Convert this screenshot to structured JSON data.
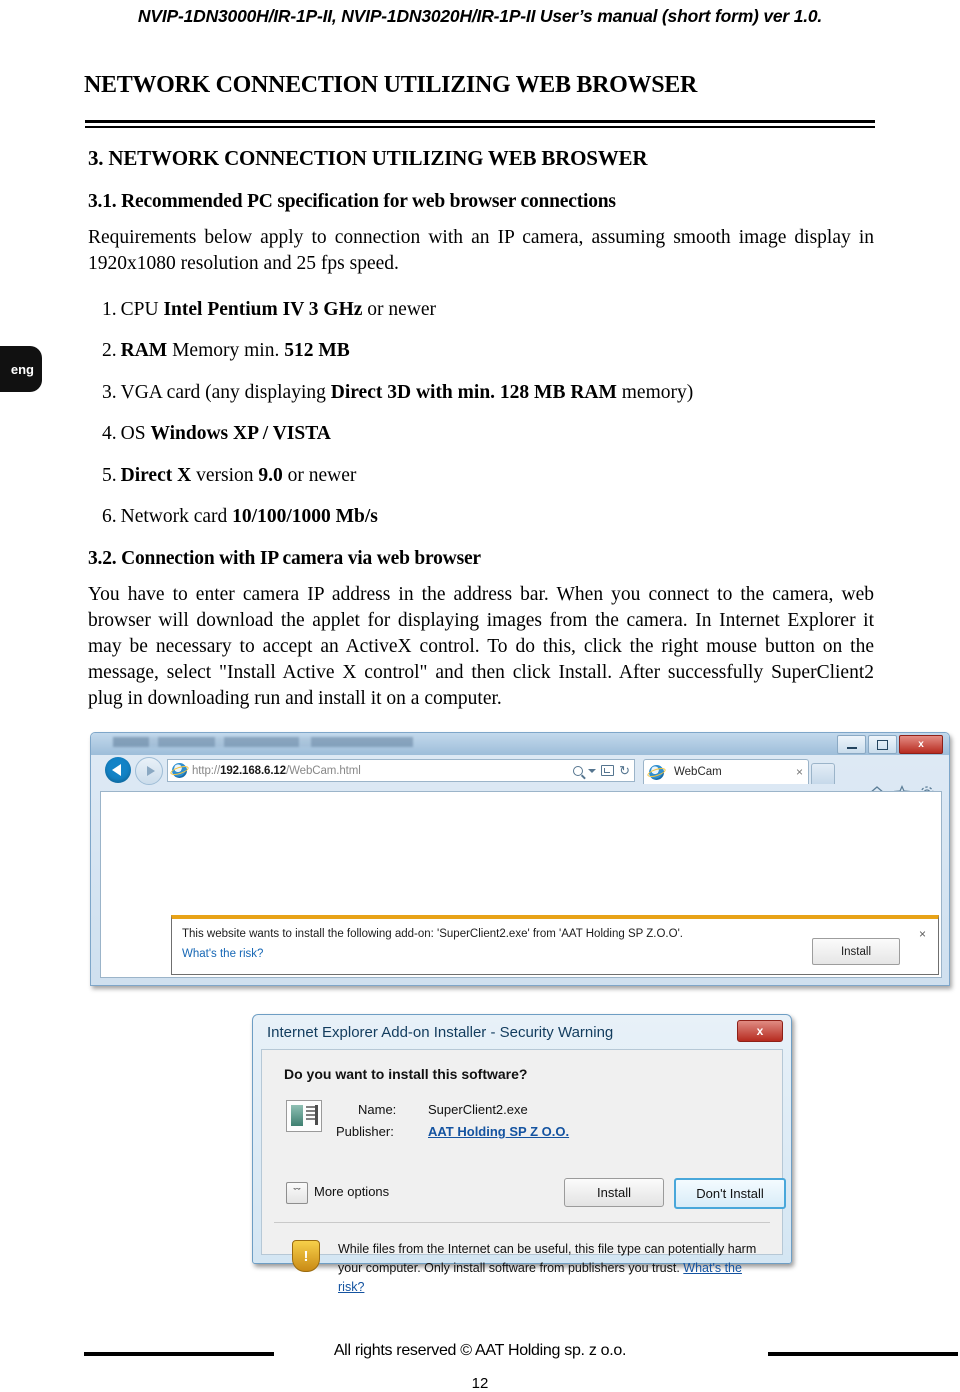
{
  "header": {
    "running_title": "NVIP-1DN3000H/IR-1P-II, NVIP-1DN3020H/IR-1P-II User’s manual (short form) ver 1.0."
  },
  "page_title": "NETWORK CONNECTION UTILIZING WEB BROWSER",
  "side_tab": {
    "label": "eng"
  },
  "sections": {
    "chapter_heading": "3. NETWORK CONNECTION UTILIZING WEB BROSWER",
    "sub_3_1": {
      "heading": "3.1. Recommended PC specification for web browser connections",
      "intro": "Requirements below apply to connection with an IP camera, assuming smooth image display in 1920x1080 resolution and 25 fps speed.",
      "items": [
        {
          "num": "1.",
          "pre": "CPU ",
          "bold": "Intel Pentium IV 3 GHz",
          "post": " or newer"
        },
        {
          "num": "2.",
          "pre": "",
          "bold": "RAM",
          "mid": " Memory min. ",
          "bold2": "512 MB",
          "post": ""
        },
        {
          "num": "3.",
          "pre": "VGA card (any displaying ",
          "bold": "Direct 3D with min. 128 MB RAM",
          "post": " memory)"
        },
        {
          "num": "4.",
          "pre": "OS ",
          "bold": "Windows XP / VISTA",
          "post": ""
        },
        {
          "num": "5.",
          "pre": "",
          "bold": "Direct X",
          "mid": " version ",
          "bold2": "9.0",
          "post": " or newer"
        },
        {
          "num": "6.",
          "pre": "Network card ",
          "bold": "10/100/1000 Mb/s",
          "post": ""
        }
      ]
    },
    "sub_3_2": {
      "heading": "3.2. Connection with IP camera via web browser",
      "paragraph": "You have to enter camera IP address in the address bar. When you connect to the camera, web browser will download the applet for displaying images from the camera. In Internet Explorer it may be necessary to accept an ActiveX control. To do this, click the right mouse button on the message, select \"Install Active X control\" and then click Install. After successfully SuperClient2 plug in downloading run and install it on a computer."
    }
  },
  "browser": {
    "url_scheme": "http://",
    "url_host": "192.168.6.12",
    "url_path": "/WebCam.html",
    "tab_label": "WebCam",
    "tab_close": "×",
    "window_buttons": {
      "minimize": "",
      "maximize": "",
      "close": "x"
    },
    "notification": {
      "message": "This website wants to install the following add-on: 'SuperClient2.exe' from 'AAT Holding SP Z.O.O'.",
      "risk_link": "What's the risk?",
      "install_button": "Install",
      "close": "×"
    }
  },
  "dialog": {
    "title": "Internet Explorer Add-on Installer - Security Warning",
    "close_label": "x",
    "question": "Do you want to install this software?",
    "name_label": "Name:",
    "name_value": "SuperClient2.exe",
    "publisher_label": "Publisher:",
    "publisher_value": "AAT Holding SP Z O.O.",
    "more_options": "More options",
    "more_options_glyph": "ˇˇ",
    "install_button": "Install",
    "dont_install_button": "Don't Install",
    "warning_text": "While files from the Internet can be useful, this file type can potentially harm your computer. Only install software from publishers you trust. ",
    "warning_link": "What's the risk?",
    "shield_glyph": "!"
  },
  "footer": {
    "copyright": "All rights reserved © AAT Holding sp. z o.o.",
    "page_number": "12"
  }
}
